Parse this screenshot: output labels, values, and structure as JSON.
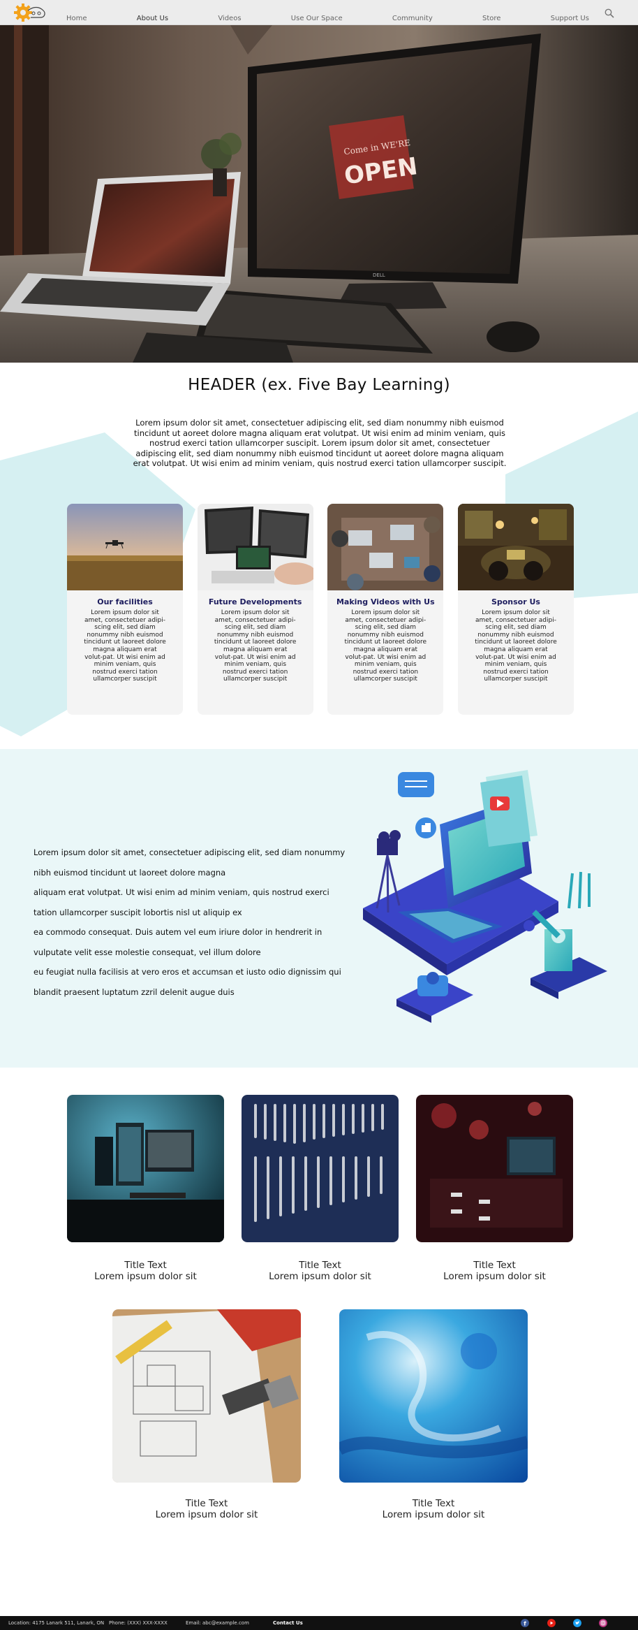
{
  "nav": {
    "items": [
      {
        "label": "Home",
        "name": "nav-home"
      },
      {
        "label": "About Us",
        "name": "nav-about-us"
      },
      {
        "label": "Videos",
        "name": "nav-videos"
      },
      {
        "label": "Use Our Space",
        "name": "nav-use-our-space"
      },
      {
        "label": "Community",
        "name": "nav-community"
      },
      {
        "label": "Store",
        "name": "nav-store"
      },
      {
        "label": "Support Us",
        "name": "nav-support-us"
      }
    ],
    "active_index": 1,
    "search_icon": "search-icon",
    "logo_icon": "gear-logo-icon"
  },
  "hero": {
    "image": "desk-laptop-monitor-photo",
    "screen_sign_line1": "Come in WE'RE",
    "screen_sign_line2": "OPEN",
    "monitor_brand": "DELL"
  },
  "intro": {
    "title": "HEADER (ex. Five Bay Learning)",
    "text": "Lorem ipsum dolor sit amet, consectetuer adipiscing elit, sed diam nonummy nibh euismod tincidunt ut aoreet dolore magna aliquam erat volutpat. Ut wisi enim ad minim veniam, quis nostrud exerci tation ullamcorper suscipit. Lorem ipsum dolor sit amet, consectetuer adipiscing elit, sed diam nonummy nibh euismod tincidunt ut aoreet dolore magna aliquam erat volutpat. Ut wisi enim ad minim veniam, quis nostrud exerci tation ullamcorper suscipit."
  },
  "cards": [
    {
      "title": "Our facilities",
      "text": "Lorem ipsum dolor sit amet, consectetuer adipi-scing elit, sed diam nonummy nibh euismod tincidunt ut laoreet dolore magna aliquam erat volut-pat. Ut wisi enim ad minim veniam, quis nostrud exerci tation ullamcorper suscipit",
      "image": "drone-field-photo"
    },
    {
      "title": "Future Developments",
      "text": "Lorem ipsum dolor sit amet, consectetuer adipi-scing elit, sed diam nonummy nibh euismod tincidunt ut laoreet dolore magna aliquam erat volut-pat. Ut wisi enim ad minim veniam, quis nostrud exerci tation ullamcorper suscipit",
      "image": "computer-monitors-photo"
    },
    {
      "title": "Making Videos with Us",
      "text": "Lorem ipsum dolor sit amet, consectetuer adipi-scing elit, sed diam nonummy nibh euismod tincidunt ut laoreet dolore magna aliquam erat volut-pat. Ut wisi enim ad minim veniam, quis nostrud exerci tation ullamcorper suscipit",
      "image": "team-table-photo"
    },
    {
      "title": "Sponsor Us",
      "text": "Lorem ipsum dolor sit amet, consectetuer adipi-scing elit, sed diam nonummy nibh euismod tincidunt ut laoreet dolore magna aliquam erat volut-pat. Ut wisi enim ad minim veniam, quis nostrud exerci tation ullamcorper suscipit",
      "image": "workshop-car-photo"
    }
  ],
  "feature": {
    "lines": [
      "Lorem ipsum dolor sit amet, consectetuer adipiscing elit, sed diam nonummy",
      "nibh euismod tincidunt ut laoreet dolore magna",
      "aliquam erat volutpat. Ut wisi enim ad minim veniam, quis nostrud exerci",
      "tation ullamcorper suscipit lobortis nisl ut aliquip ex",
      "ea commodo consequat. Duis autem vel eum iriure dolor in hendrerit in",
      "vulputate velit esse molestie consequat, vel illum dolore",
      "eu feugiat nulla facilisis at vero eros et accumsan et iusto odio dignissim qui",
      "blandit praesent luptatum zzril delenit augue duis"
    ],
    "illustration": "isometric-laptop-illustration"
  },
  "gallery": [
    {
      "title": "Title Text",
      "sub": "Lorem ipsum dolor sit",
      "image": "pc-setup-photo"
    },
    {
      "title": "Title Text",
      "sub": "Lorem ipsum dolor sit",
      "image": "wrench-rack-photo"
    },
    {
      "title": "Title Text",
      "sub": "Lorem ipsum dolor sit",
      "image": "red-studio-laptop-photo"
    },
    {
      "title": "Title Text",
      "sub": "Lorem ipsum dolor sit",
      "image": "blueprint-tools-photo"
    },
    {
      "title": "Title Text",
      "sub": "Lorem ipsum dolor sit",
      "image": "blue-abstract-photo"
    }
  ],
  "footer": {
    "location": "Location: 4175 Lanark 511, Lanark, ON",
    "phone": "Phone: (XXX) XXX-XXXX",
    "email": "Email: abc@example.com",
    "contact": "Contact Us",
    "social": [
      "facebook-icon",
      "youtube-icon",
      "twitter-icon",
      "instagram-icon"
    ],
    "colors": {
      "facebook": "#3b5998",
      "youtube": "#e62117",
      "twitter": "#1da1f2",
      "instagram": "#c13584"
    }
  },
  "colors": {
    "teal_shape": "#d6f0f2",
    "feature_bg": "#eaf7f8",
    "card_bg": "#f4f4f4",
    "card_title": "#1d1d5e",
    "nav_bg": "#ececec",
    "footer_bg": "#111111"
  }
}
